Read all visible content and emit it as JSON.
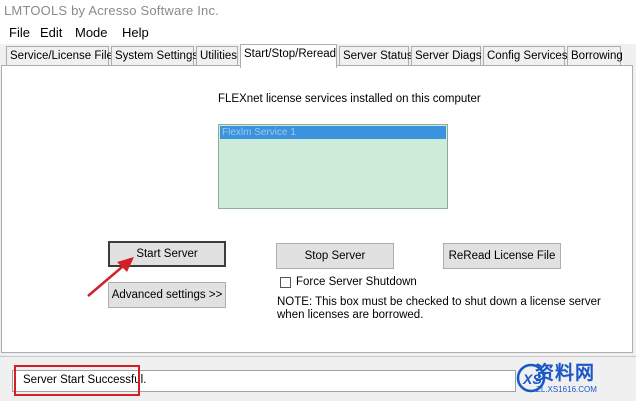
{
  "window": {
    "title": "LMTOOLS by Acresso Software Inc."
  },
  "menu": [
    "File",
    "Edit",
    "Mode",
    "Help"
  ],
  "tabs": [
    {
      "label": "Service/License File"
    },
    {
      "label": "System Settings"
    },
    {
      "label": "Utilities"
    },
    {
      "label": "Start/Stop/Reread"
    },
    {
      "label": "Server Status"
    },
    {
      "label": "Server Diags"
    },
    {
      "label": "Config Services"
    },
    {
      "label": "Borrowing"
    }
  ],
  "active_tab": "Start/Stop/Reread",
  "panel": {
    "services_header": "FLEXnet license services installed on this computer",
    "selected_service": "Flexlm Service 1",
    "buttons": {
      "start": "Start Server",
      "stop": "Stop Server",
      "reread": "ReRead License File",
      "advanced": "Advanced settings >>"
    },
    "force_shutdown": {
      "label": "Force Server Shutdown",
      "checked": false
    },
    "note": [
      "NOTE:  This box must be checked to shut down a license server",
      "when licenses are borrowed."
    ]
  },
  "status": {
    "text": "Server Start Successful."
  },
  "watermark": {
    "brand": "资料网",
    "url": "ZL.XS1616.COM"
  },
  "colors": {
    "listbox_bg": "#cdebd9",
    "selection": "#3b93e0",
    "annotation": "#d32027",
    "watermark": "#1a57c7"
  }
}
